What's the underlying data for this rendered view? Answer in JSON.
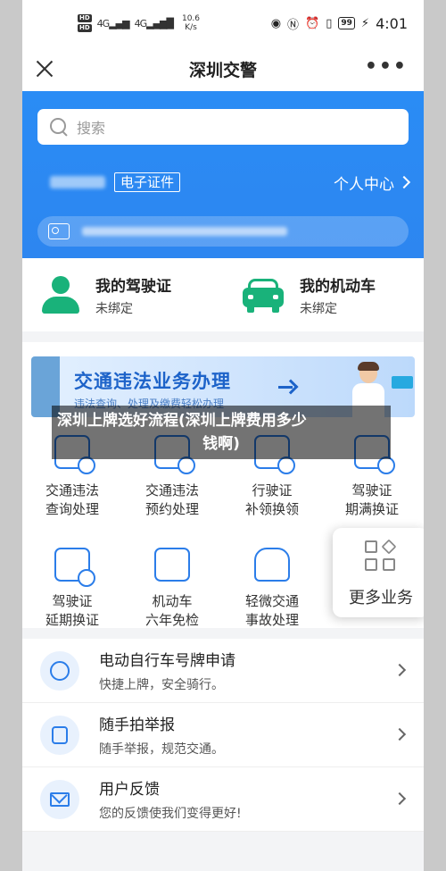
{
  "status_bar": {
    "hd1": "HD",
    "hd2": "HD",
    "net1": "4G",
    "net2": "4G",
    "speed_value": "10.6",
    "speed_unit": "K/s",
    "battery": "99",
    "time": "4:01"
  },
  "titlebar": {
    "title": "深圳交警",
    "more": "•••"
  },
  "header": {
    "search_placeholder": "搜索",
    "ecert_label": "电子证件",
    "personal_center": "个人中心"
  },
  "cards": [
    {
      "title": "我的驾驶证",
      "status": "未绑定"
    },
    {
      "title": "我的机动车",
      "status": "未绑定"
    }
  ],
  "banner": {
    "title": "交通违法业务办理",
    "subtitle": "违法查询、处理及缴费轻松办理"
  },
  "overlay": {
    "line1": "深圳上牌选好流程(深圳上牌费用多少",
    "line2": "钱啊)"
  },
  "grid": [
    [
      "交通违法",
      "查询处理"
    ],
    [
      "交通违法",
      "预约处理"
    ],
    [
      "行驶证",
      "补领换领"
    ],
    [
      "驾驶证",
      "期满换证"
    ],
    [
      "驾驶证",
      "延期换证"
    ],
    [
      "机动车",
      "六年免检"
    ],
    [
      "轻微交通",
      "事故处理"
    ]
  ],
  "more_services": "更多业务",
  "list": [
    {
      "title": "电动自行车号牌申请",
      "subtitle": "快捷上牌，安全骑行。"
    },
    {
      "title": "随手拍举报",
      "subtitle": "随手举报，规范交通。"
    },
    {
      "title": "用户反馈",
      "subtitle": "您的反馈使我们变得更好!"
    }
  ],
  "colors": {
    "brand_blue": "#2d86f0",
    "accent_green": "#19b27a",
    "icon_blue": "#2b7de9"
  }
}
